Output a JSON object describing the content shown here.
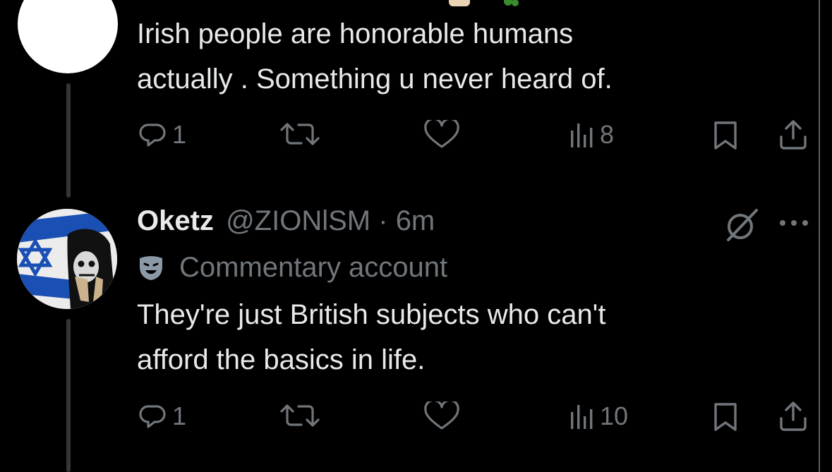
{
  "tweet1": {
    "text_line1": "Irish people are honorable humans",
    "text_line2": "actually . Something u never heard of.",
    "reply_count": "1",
    "view_count": "8"
  },
  "tweet2": {
    "display_name": "Oketz",
    "handle": "@ZIONlSM",
    "separator": "·",
    "time": "6m",
    "label": "Commentary account",
    "text_line1": "They're just British subjects who can't",
    "text_line2": "afford the basics in life.",
    "reply_count": "1",
    "view_count": "10"
  },
  "colors": {
    "background": "#000000",
    "text": "#e7e9ea",
    "muted": "#71767b",
    "flag_blue": "#1a4fb4"
  },
  "icons": [
    "reply-icon",
    "retweet-icon",
    "like-icon",
    "views-icon",
    "bookmark-icon",
    "share-icon",
    "grok-icon",
    "more-icon",
    "commentary-label-icon"
  ]
}
